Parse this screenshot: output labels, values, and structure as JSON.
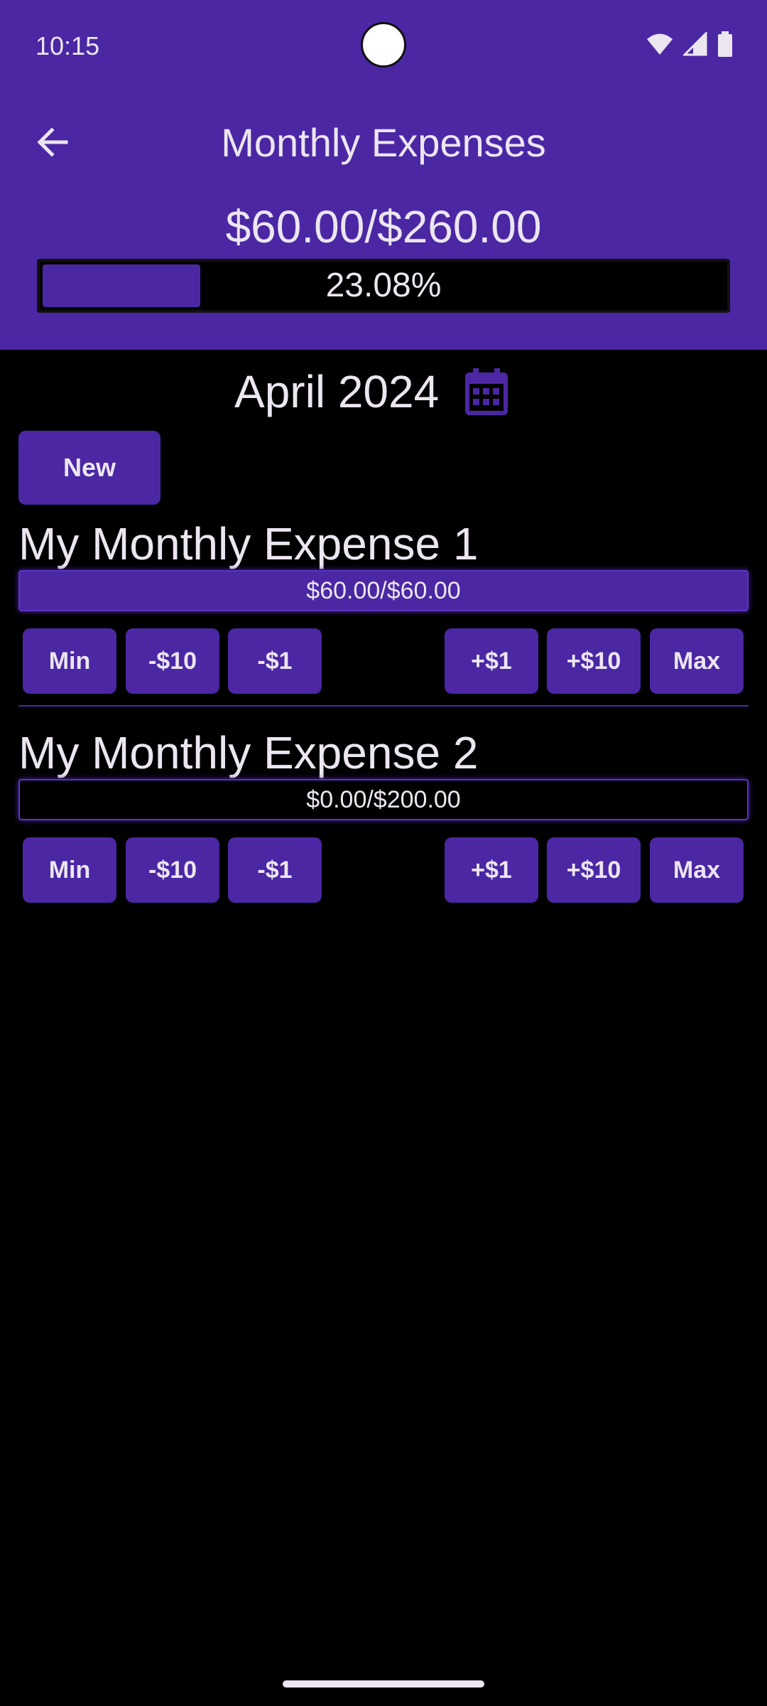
{
  "status_bar": {
    "time": "10:15",
    "icons": [
      "wifi-icon",
      "signal-icon",
      "battery-icon"
    ]
  },
  "header": {
    "back_icon": "arrow-back-icon",
    "title": "Monthly Expenses",
    "total_text": "$60.00/$260.00",
    "progress_text": "23.08%",
    "progress_fraction": 0.2308
  },
  "month": {
    "label": "April 2024",
    "calendar_icon": "calendar-icon"
  },
  "new_button": {
    "label": "New"
  },
  "buttons": {
    "min": "Min",
    "minus10": "-$10",
    "minus1": "-$1",
    "plus1": "+$1",
    "plus10": "+$10",
    "max": "Max"
  },
  "expenses": [
    {
      "name": "My Monthly Expense 1",
      "amount_text": "$60.00/$60.00",
      "fill_fraction": 1.0
    },
    {
      "name": "My Monthly Expense 2",
      "amount_text": "$0.00/$200.00",
      "fill_fraction": 0.0
    }
  ],
  "colors": {
    "accent": "#4b27a4",
    "background": "#000000",
    "text": "#ece6f0"
  }
}
